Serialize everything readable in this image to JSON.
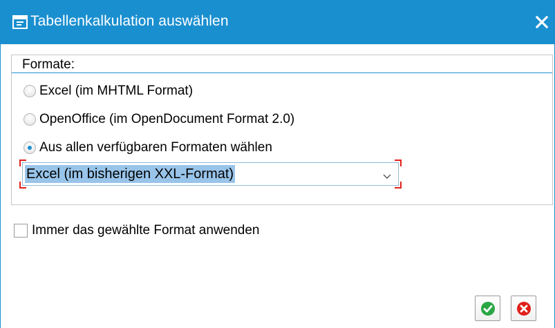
{
  "dialog": {
    "title": "Tabellenkalkulation auswählen",
    "title_icon": "dialog-window-icon",
    "close_icon": "close-icon"
  },
  "formats": {
    "group_title": "Formate:",
    "options": [
      {
        "label": "Excel (im MHTML Format)",
        "selected": false
      },
      {
        "label": "OpenOffice (im OpenDocument Format 2.0)",
        "selected": false
      },
      {
        "label": "Aus allen verfügbaren Formaten wählen",
        "selected": true
      }
    ],
    "dropdown": {
      "selected_value": "Excel (im bisherigen XXL-Format)"
    }
  },
  "always_use": {
    "label": "Immer das gewählte Format anwenden",
    "checked": false
  },
  "buttons": {
    "confirm_icon": "checkmark-icon",
    "cancel_icon": "cancel-icon"
  },
  "colors": {
    "titlebar": "#1a8fd0",
    "confirm": "#2aa745",
    "cancel": "#e0201a",
    "required_marker": "#e0201a",
    "selection_highlight": "#99c4ea"
  }
}
